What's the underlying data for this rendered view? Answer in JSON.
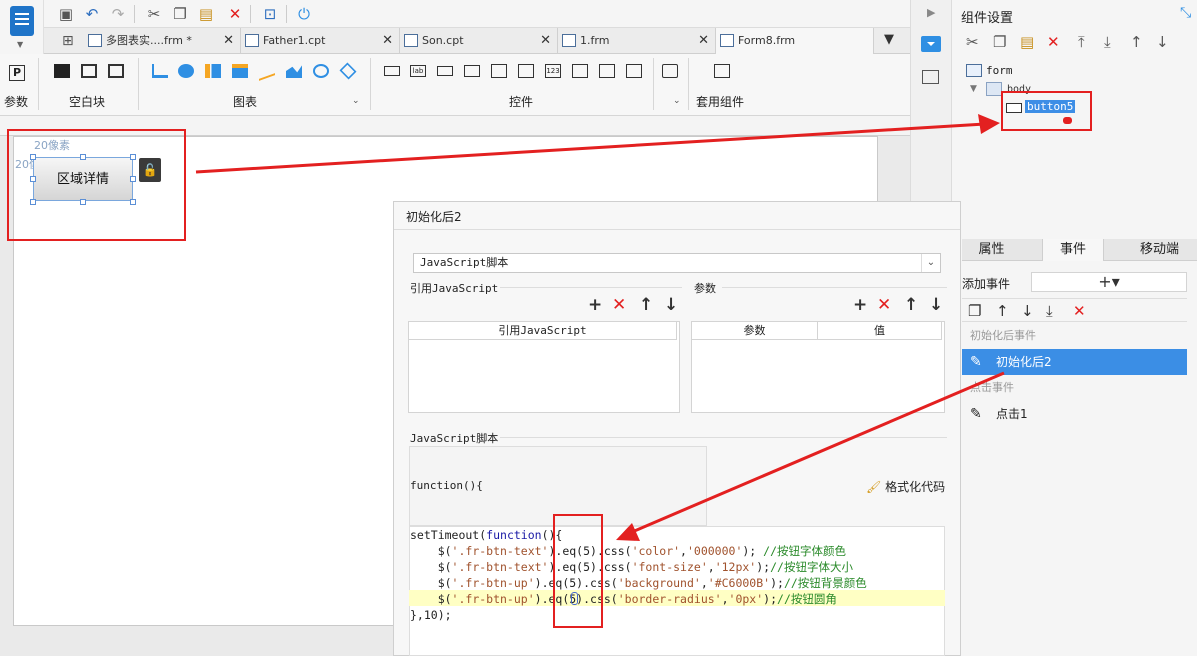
{
  "tabs": [
    {
      "label": "多图表实....frm *",
      "closable": true
    },
    {
      "label": "Father1.cpt",
      "closable": true
    },
    {
      "label": "Son.cpt",
      "closable": true
    },
    {
      "label": "1.frm",
      "closable": true
    },
    {
      "label": "Form8.frm",
      "closable": false
    }
  ],
  "ribbon": {
    "groups": [
      "参数",
      "空白块",
      "图表",
      "控件",
      "套用组件"
    ],
    "param_glyph": "P"
  },
  "canvas": {
    "ruler_top": "20像素",
    "ruler_left": "20像素",
    "widget_label": "区域详情"
  },
  "component_panel": {
    "title": "组件设置",
    "tree": {
      "root": "form",
      "body": "body",
      "widget": "button5"
    },
    "tabs": [
      "属性",
      "事件",
      "移动端"
    ],
    "add_event_label": "添加事件",
    "add_event_glyph": "+▾",
    "sections": [
      {
        "label": "初始化后事件",
        "items": [
          {
            "label": "初始化后2",
            "selected": true
          }
        ]
      },
      {
        "label": "点击事件",
        "items": [
          {
            "label": "点击1",
            "selected": false
          }
        ]
      }
    ]
  },
  "dialog": {
    "title": "初始化后2",
    "script_type": "JavaScript脚本",
    "ref_section": "引用JavaScript",
    "param_section": "参数",
    "ref_table_header": "引用JavaScript",
    "param_headers": [
      "参数",
      "值"
    ],
    "script_section": "JavaScript脚本",
    "function_header": "function(){",
    "format_button": "格式化代码",
    "code": [
      {
        "parts": [
          [
            "",
            "setTimeout("
          ],
          [
            "kw",
            "function"
          ],
          [
            "",
            "(){"
          ]
        ]
      },
      {
        "parts": [
          [
            "",
            "    $("
          ],
          [
            "str",
            "'.fr-btn-text'"
          ],
          [
            "",
            ").eq(5).css("
          ],
          [
            "str",
            "'color'"
          ],
          [
            "",
            ","
          ],
          [
            "str",
            "'000000'"
          ],
          [
            "",
            "); "
          ],
          [
            "cm",
            "//按钮字体颜色"
          ]
        ]
      },
      {
        "parts": [
          [
            "",
            "    $("
          ],
          [
            "str",
            "'.fr-btn-text'"
          ],
          [
            "",
            ").eq(5).css("
          ],
          [
            "str",
            "'font-size'"
          ],
          [
            "",
            ","
          ],
          [
            "str",
            "'12px'"
          ],
          [
            "",
            ");"
          ],
          [
            "cm",
            "//按钮字体大小"
          ]
        ]
      },
      {
        "parts": [
          [
            "",
            "    $("
          ],
          [
            "str",
            "'.fr-btn-up'"
          ],
          [
            "",
            ").eq(5).css("
          ],
          [
            "str",
            "'background'"
          ],
          [
            "",
            ","
          ],
          [
            "str",
            "'#C6000B'"
          ],
          [
            "",
            ");"
          ],
          [
            "cm",
            "//按钮背景颜色"
          ]
        ]
      },
      {
        "parts": [
          [
            "",
            "    $("
          ],
          [
            "str",
            "'.fr-btn-up'"
          ],
          [
            "",
            ").eq(5).css("
          ],
          [
            "str",
            "'border-radius'"
          ],
          [
            "",
            ","
          ],
          [
            "str",
            "'0px'"
          ],
          [
            "",
            ");"
          ],
          [
            "cm",
            "//按钮圆角"
          ]
        ]
      },
      {
        "parts": [
          [
            "",
            "},10);"
          ]
        ]
      }
    ]
  },
  "colors": {
    "accent": "#3b8ee5",
    "annotation": "#e32020"
  }
}
